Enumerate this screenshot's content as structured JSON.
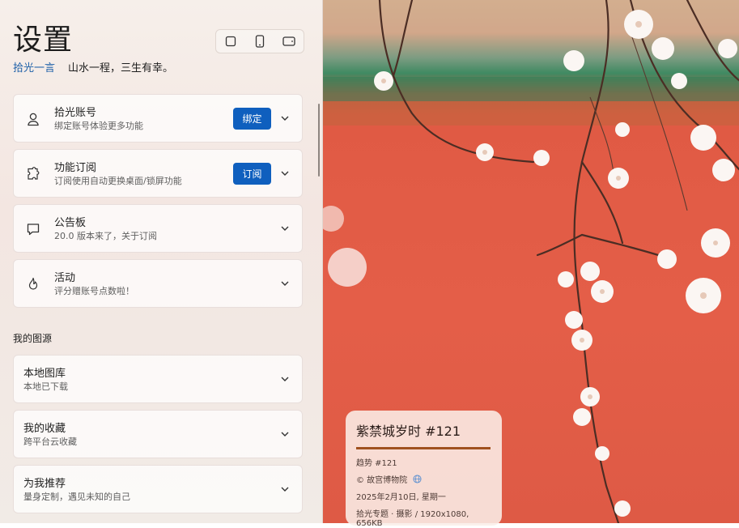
{
  "settings": {
    "title": "设置",
    "subtitle_brand": "拾光一言",
    "subtitle_quote": "山水一程，三生有幸。",
    "cards": [
      {
        "title": "拾光账号",
        "desc": "绑定账号体验更多功能",
        "button": "绑定",
        "icon": "user-icon"
      },
      {
        "title": "功能订阅",
        "desc": "订阅使用自动更换桌面/锁屏功能",
        "button": "订阅",
        "icon": "puzzle-icon"
      },
      {
        "title": "公告板",
        "desc": "20.0 版本来了，关于订阅",
        "icon": "message-icon"
      },
      {
        "title": "活动",
        "desc": "评分赠账号点数啦！",
        "icon": "flame-icon"
      }
    ],
    "section_title": "我的图源",
    "source_cards": [
      {
        "title": "本地图库",
        "desc": "本地已下载"
      },
      {
        "title": "我的收藏",
        "desc": "跨平台云收藏"
      },
      {
        "title": "为我推荐",
        "desc": "量身定制，遇见未知的自己"
      }
    ]
  },
  "wallpaper_info": {
    "title": "紫禁城岁时 #121",
    "category": "趋势 #121",
    "copyright": "© 故宫博物院",
    "date": "2025年2月10日, 星期一",
    "meta": "拾光专题 · 摄影 / 1920x1080, 656KB"
  }
}
